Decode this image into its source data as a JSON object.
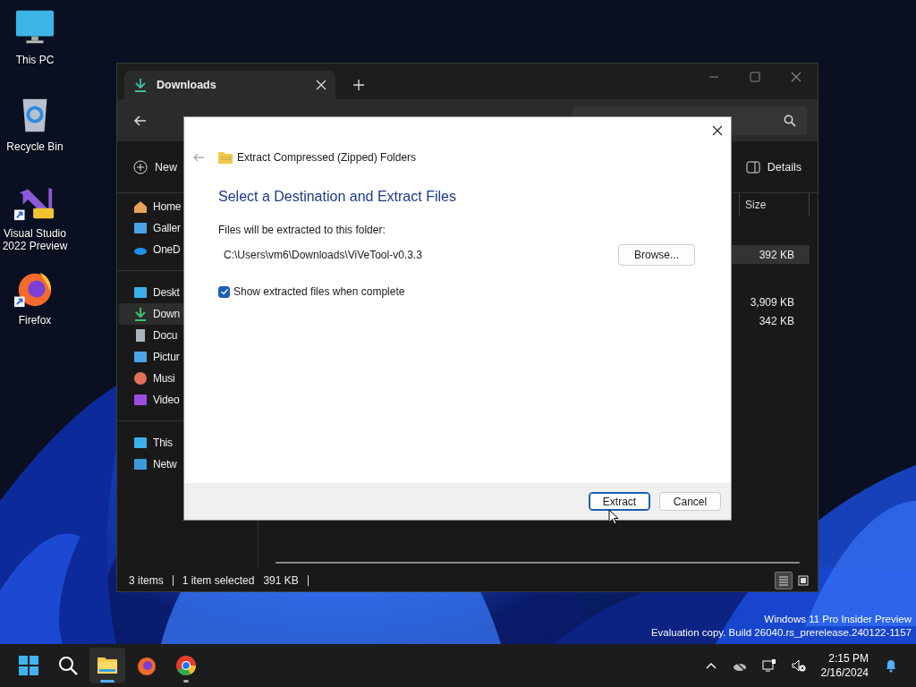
{
  "desktop": {
    "icons": [
      {
        "label": "This PC",
        "kind": "pc",
        "shortcut": false
      },
      {
        "label": "Recycle Bin",
        "kind": "bin",
        "shortcut": false
      },
      {
        "label": "Visual Studio 2022 Preview",
        "kind": "vs",
        "shortcut": true
      },
      {
        "label": "Firefox",
        "kind": "firefox",
        "shortcut": true
      }
    ],
    "edition_notice": [
      "Windows 11 Pro Insider Preview",
      "Evaluation copy. Build 26040.rs_prerelease.240122-1157"
    ]
  },
  "explorer": {
    "tabs": [
      {
        "label": "Downloads",
        "selected": true
      }
    ],
    "toolbar": {
      "new": "New",
      "details": "Details"
    },
    "sidebar": [
      [
        {
          "label": "Home",
          "kind": "home",
          "selected": false
        },
        {
          "label": "Galler",
          "kind": "gallery",
          "selected": false
        },
        {
          "label": "OneD",
          "kind": "onedrive",
          "selected": false
        }
      ],
      [
        {
          "label": "Deskt",
          "kind": "desktop",
          "selected": false
        },
        {
          "label": "Down",
          "kind": "downloads",
          "selected": true
        },
        {
          "label": "Docu",
          "kind": "documents",
          "selected": false
        },
        {
          "label": "Pictur",
          "kind": "pictures",
          "selected": false
        },
        {
          "label": "Musi",
          "kind": "music",
          "selected": false
        },
        {
          "label": "Video",
          "kind": "videos",
          "selected": false
        }
      ],
      [
        {
          "label": "This",
          "kind": "thispc",
          "selected": false
        },
        {
          "label": "Netw",
          "kind": "network",
          "selected": false
        }
      ]
    ],
    "columns": [
      "Size"
    ],
    "groups": [
      {
        "rows": [
          {
            "size": "392 KB",
            "selected": true
          }
        ]
      },
      {
        "rows": [
          {
            "size": "3,909 KB",
            "selected": false
          },
          {
            "size": "342 KB",
            "selected": false
          }
        ]
      }
    ],
    "status_bar": {
      "count": "3 items",
      "selection": "1 item selected",
      "selection_size": "391 KB"
    },
    "view_buttons": [
      {
        "kind": "details",
        "selected": true
      },
      {
        "kind": "tiles",
        "selected": false
      }
    ]
  },
  "dialog": {
    "title": "Extract Compressed (Zipped) Folders",
    "heading": "Select a Destination and Extract Files",
    "folder_label": "Files will be extracted to this folder:",
    "path": "C:\\Users\\vm6\\Downloads\\ViVeTool-v0.3.3",
    "browse": "Browse...",
    "show_files": {
      "label": "Show extracted files when complete",
      "checked": true
    },
    "buttons": [
      {
        "label": "Extract",
        "default": true
      },
      {
        "label": "Cancel",
        "default": false
      }
    ]
  },
  "taskbar": {
    "apps": [
      {
        "kind": "start",
        "active": false,
        "running": false
      },
      {
        "kind": "search",
        "active": false,
        "running": false
      },
      {
        "kind": "explorer",
        "active": true,
        "running": true
      },
      {
        "kind": "firefox",
        "active": false,
        "running": false
      },
      {
        "kind": "chrome",
        "active": false,
        "running": true
      }
    ],
    "time": "2:15 PM",
    "date": "2/16/2024"
  }
}
